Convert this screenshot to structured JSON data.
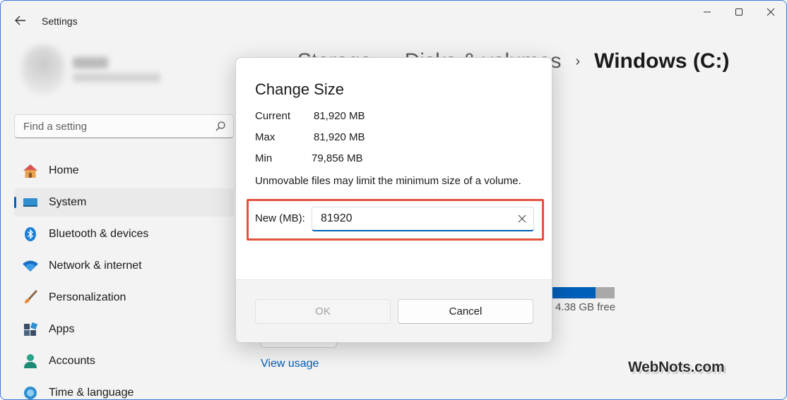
{
  "window": {
    "title": "Settings"
  },
  "search": {
    "placeholder": "Find a setting",
    "value": ""
  },
  "sidebar": {
    "items": [
      {
        "label": "Home",
        "icon": "home-icon"
      },
      {
        "label": "System",
        "icon": "monitor-icon",
        "selected": true
      },
      {
        "label": "Bluetooth & devices",
        "icon": "bluetooth-icon"
      },
      {
        "label": "Network & internet",
        "icon": "wifi-icon"
      },
      {
        "label": "Personalization",
        "icon": "brush-icon"
      },
      {
        "label": "Apps",
        "icon": "apps-icon"
      },
      {
        "label": "Accounts",
        "icon": "person-icon"
      },
      {
        "label": "Time & language",
        "icon": "globe-clock-icon"
      }
    ]
  },
  "breadcrumb": {
    "items": [
      "Storage",
      "Disks & volumes"
    ],
    "current": "Windows (C:)"
  },
  "background": {
    "usage_fraction": 0.7,
    "free_text": "4.38 GB free",
    "view_usage": "View usage"
  },
  "dialog": {
    "title": "Change Size",
    "current_label": "Current",
    "current_value": "81,920 MB",
    "max_label": "Max",
    "max_value": "81,920 MB",
    "min_label": "Min",
    "min_value": "79,856 MB",
    "note": "Unmovable files may limit the minimum size of a volume.",
    "new_label": "New (MB):",
    "new_value": "81920",
    "ok_label": "OK",
    "cancel_label": "Cancel"
  },
  "watermark": "WebNots.com",
  "colors": {
    "accent": "#005fb8",
    "highlight": "#e0533c"
  }
}
